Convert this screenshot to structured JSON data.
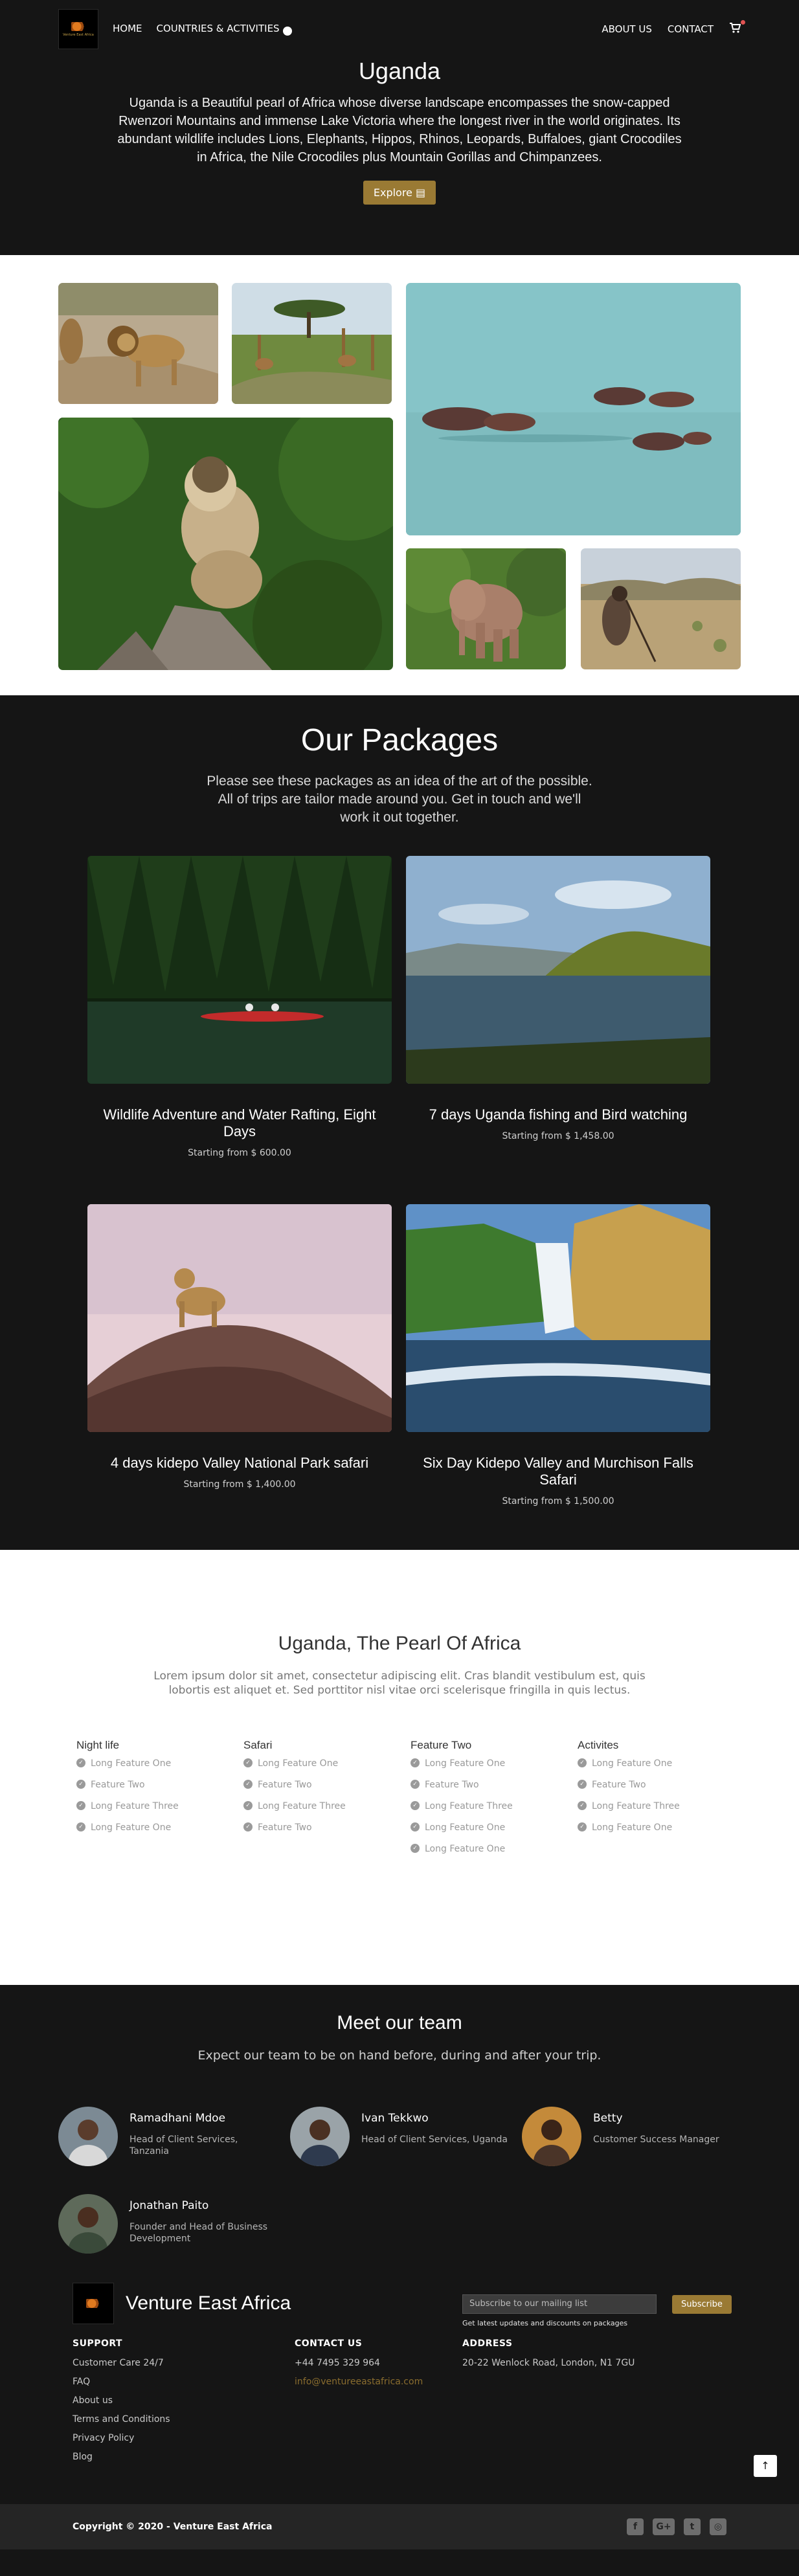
{
  "nav": {
    "logo_text": "Venture East Africa",
    "home": "HOME",
    "countries": "COUNTRIES & ACTIVITIES",
    "about": "ABOUT US",
    "contact": "CONTACT"
  },
  "hero": {
    "title": "Uganda",
    "description": "Uganda is a Beautiful pearl of Africa whose diverse landscape encompasses the snow-capped Rwenzori Mountains and immense Lake Victoria where the longest river in the world originates. Its abundant wildlife includes Lions, Elephants, Hippos, Rhinos, Leopards, Buffaloes, giant Crocodiles in Africa, the Nile Crocodiles plus Mountain Gorillas and Chimpanzees.",
    "button": "Explore"
  },
  "packages": {
    "title": "Our Packages",
    "lead": "Please see these packages as an idea of the art of the possible. All of trips are tailor made around you. Get in touch and we'll work it out together.",
    "items": [
      {
        "title": "Wildlife Adventure and Water Rafting, Eight Days",
        "price": "Starting from  $ 600.00"
      },
      {
        "title": "7 days Uganda fishing and Bird watching",
        "price": "Starting from  $ 1,458.00"
      },
      {
        "title": "4 days kidepo Valley National Park safari",
        "price": "Starting from  $ 1,400.00"
      },
      {
        "title": "Six Day Kidepo Valley and Murchison Falls Safari",
        "price": "Starting from  $ 1,500.00"
      }
    ]
  },
  "pearl": {
    "title": "Uganda, The Pearl Of Africa",
    "lead": "Lorem ipsum dolor sit amet, consectetur adipiscing elit. Cras blandit vestibulum est, quis lobortis est aliquet et. Sed porttitor nisl vitae orci scelerisque fringilla in quis lectus.",
    "columns": [
      {
        "heading": "Night life",
        "items": [
          "Long Feature One",
          "Feature Two",
          "Long Feature Three",
          "Long Feature One"
        ]
      },
      {
        "heading": "Safari",
        "items": [
          "Long Feature One",
          "Feature Two",
          "Long Feature Three",
          "Feature Two"
        ]
      },
      {
        "heading": "Feature Two",
        "items": [
          "Long Feature One",
          "Feature Two",
          "Long Feature Three",
          "Long Feature One",
          "Long Feature One"
        ]
      },
      {
        "heading": "Activites",
        "items": [
          "Long Feature One",
          "Feature Two",
          "Long Feature Three",
          "Long Feature One"
        ]
      }
    ]
  },
  "team": {
    "title": "Meet our team",
    "lead": "Expect our team to be on hand before, during and after your trip.",
    "members": [
      {
        "name": "Ramadhani Mdoe",
        "role": "Head of Client Services, Tanzania"
      },
      {
        "name": "Ivan Tekkwo",
        "role": "Head of Client Services, Uganda"
      },
      {
        "name": "Betty",
        "role": "Customer Success Manager"
      },
      {
        "name": "Jonathan Paito",
        "role": "Founder and Head of Business Development"
      }
    ]
  },
  "footer": {
    "brand": "Venture East Africa",
    "subscribe_placeholder": "Subscribe to our mailing list",
    "subscribe_button": "Subscribe",
    "subscribe_note": "Get latest updates and discounts on packages",
    "support": {
      "heading": "SUPPORT",
      "items": [
        "Customer Care 24/7",
        "FAQ",
        "About us",
        "Terms and Conditions",
        "Privacy Policy",
        "Blog"
      ]
    },
    "contact": {
      "heading": "CONTACT US",
      "phone": "+44 7495 329 964",
      "email": "info@ventureeastafrica.com"
    },
    "address": {
      "heading": "ADDRESS",
      "line": "20-22 Wenlock Road, London, N1 7GU"
    },
    "copyright": "Copyright © 2020 - Venture East Africa"
  }
}
